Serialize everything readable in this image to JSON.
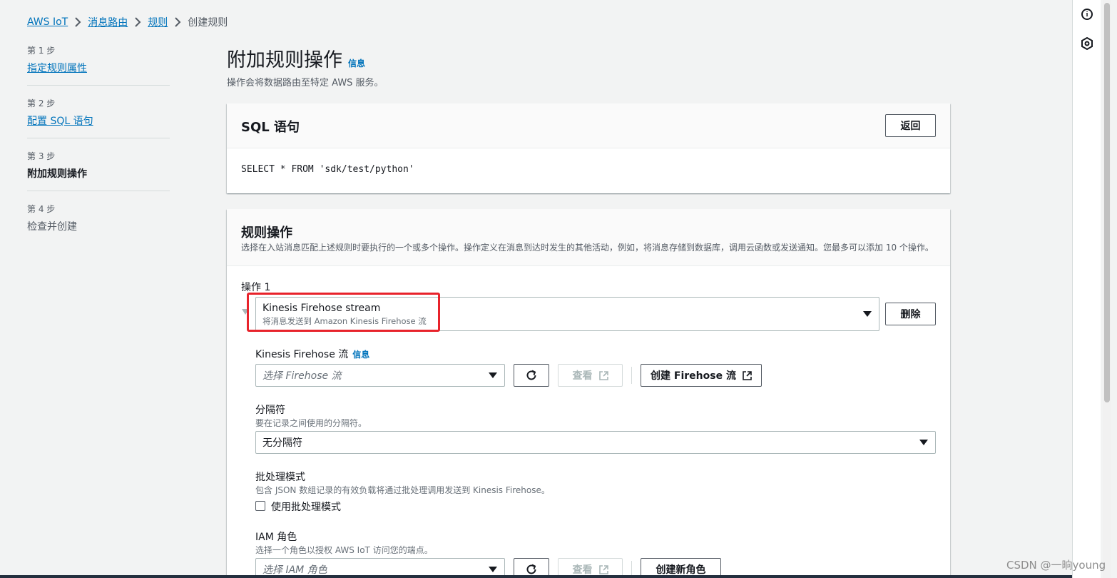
{
  "breadcrumb": {
    "items": [
      "AWS IoT",
      "消息路由",
      "规则"
    ],
    "current": "创建规则"
  },
  "steps": [
    {
      "num": "第 1 步",
      "title": "指定规则属性"
    },
    {
      "num": "第 2 步",
      "title": "配置 SQL 语句"
    },
    {
      "num": "第 3 步",
      "title": "附加规则操作"
    },
    {
      "num": "第 4 步",
      "title": "检查并创建"
    }
  ],
  "page": {
    "title": "附加规则操作",
    "info": "信息",
    "description": "操作会将数据路由至特定 AWS 服务。"
  },
  "sql_card": {
    "title": "SQL 语句",
    "back_label": "返回",
    "statement": "SELECT * FROM 'sdk/test/python'"
  },
  "actions_card": {
    "title": "规则操作",
    "description": "选择在入站消息匹配上述规则时要执行的一个或多个操作。操作定义在消息到达时发生的其他活动，例如，将消息存储到数据库，调用云函数或发送通知。您最多可以添加 10 个操作。",
    "action_label": "操作 1",
    "action_select": {
      "title": "Kinesis Firehose stream",
      "subtitle": "将消息发送到 Amazon Kinesis Firehose 流"
    },
    "delete_label": "删除",
    "firehose": {
      "label": "Kinesis Firehose 流",
      "info": "信息",
      "placeholder": "选择 Firehose 流",
      "view_label": "查看",
      "create_label": "创建 Firehose 流"
    },
    "separator": {
      "label": "分隔符",
      "hint": "要在记录之间使用的分隔符。",
      "value": "无分隔符"
    },
    "batch": {
      "label": "批处理模式",
      "hint": "包含 JSON 数组记录的有效负载将通过批处理调用发送到 Kinesis Firehose。",
      "checkbox_label": "使用批处理模式",
      "checked": false
    },
    "iam": {
      "label": "IAM 角色",
      "hint": "选择一个角色以授权 AWS IoT 访问您的端点。",
      "placeholder": "选择 IAM 角色",
      "view_label": "查看",
      "create_label": "创建新角色"
    }
  },
  "watermark": "CSDN @一晌young",
  "colors": {
    "link": "#0073bb",
    "highlight": "#e8232b",
    "background": "#f2f3f3"
  }
}
